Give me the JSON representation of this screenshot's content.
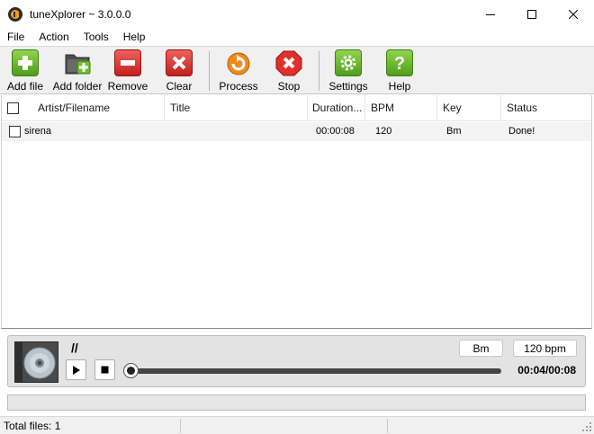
{
  "window": {
    "title": "tuneXplorer ~ 3.0.0.0",
    "accent_color": "#f2a017"
  },
  "menu": {
    "items": [
      {
        "label": "File"
      },
      {
        "label": "Action"
      },
      {
        "label": "Tools"
      },
      {
        "label": "Help"
      }
    ]
  },
  "toolbar": {
    "add_file": "Add file",
    "add_folder": "Add folder",
    "remove": "Remove",
    "clear": "Clear",
    "process": "Process",
    "stop": "Stop",
    "settings": "Settings",
    "help": "Help"
  },
  "list": {
    "columns": {
      "artist": "Artist/Filename",
      "title": "Title",
      "duration": "Duration...",
      "bpm": "BPM",
      "key": "Key",
      "status": "Status"
    },
    "rows": [
      {
        "artist": "sirena",
        "title": "",
        "duration": "00:00:08",
        "bpm": "120",
        "key": "Bm",
        "status": "Done!",
        "checked": false
      }
    ]
  },
  "player": {
    "track_title": "//",
    "key_badge": "Bm",
    "bpm_badge": "120 bpm",
    "time": "00:04/00:08",
    "seek_position": 0.0
  },
  "progress": {
    "value": 0,
    "color": "#06b025"
  },
  "status": {
    "total_files": "Total files: 1"
  }
}
